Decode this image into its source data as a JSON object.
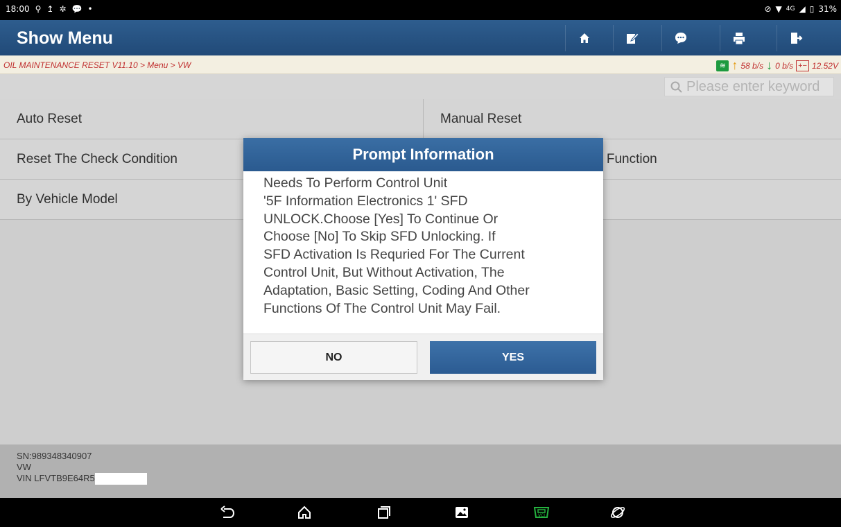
{
  "status_bar": {
    "time": "18:00",
    "left_icons": [
      "usb-icon",
      "upload-icon",
      "settings-alert-icon",
      "chat-icon",
      "dot-icon"
    ],
    "network": "4G",
    "battery": "31%"
  },
  "header": {
    "title": "Show Menu",
    "buttons": [
      "home-icon",
      "edit-icon",
      "message-icon",
      "print-icon",
      "exit-icon"
    ]
  },
  "breadcrumb": "OIL MAINTENANCE RESET V11.10 > Menu > VW",
  "network_status": {
    "upload": "58 b/s",
    "download": "0 b/s",
    "voltage": "12.52V"
  },
  "search": {
    "placeholder": "Please enter keyword"
  },
  "menu": {
    "items": [
      "Auto Reset",
      "Manual Reset",
      "Reset The Check Condition",
      "e Function",
      "By Vehicle Model"
    ]
  },
  "dialog": {
    "title": "Prompt Information",
    "message_lines": [
      "Needs To Perform Control Unit",
      "'5F Information Electronics 1' SFD",
      "UNLOCK.Choose [Yes] To Continue Or",
      "Choose [No] To Skip SFD Unlocking. If",
      "SFD Activation Is Requried For The Current",
      "Control Unit, But Without Activation, The",
      "Adaptation, Basic Setting, Coding And Other",
      "Functions Of The Control Unit May Fail."
    ],
    "no_label": "NO",
    "yes_label": "YES"
  },
  "footer": {
    "sn": "SN:989348340907",
    "make": "VW",
    "vin": "VIN LFVTB9E64R5"
  },
  "nav_bar": {
    "icons": [
      "back-icon",
      "home-icon",
      "recents-icon",
      "gallery-icon",
      "vci-icon",
      "browser-icon"
    ]
  },
  "colors": {
    "header_blue": "#2a5a8f",
    "breadcrumb_red": "#c03030",
    "yes_button": "#2b5b92"
  }
}
